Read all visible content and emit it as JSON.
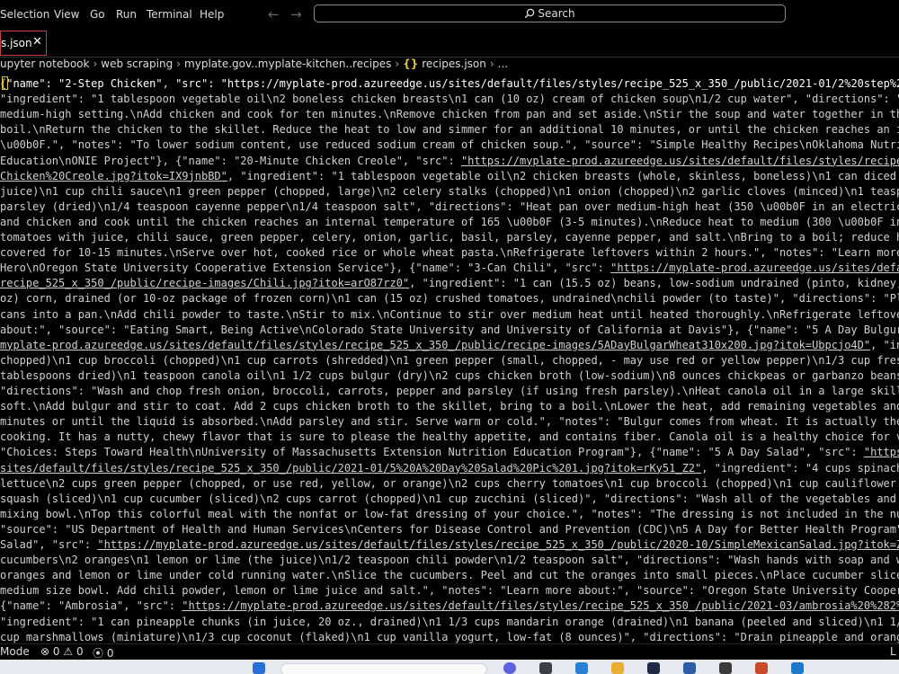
{
  "menu": {
    "items": [
      "Selection",
      "View",
      "Go",
      "Run",
      "Terminal",
      "Help"
    ]
  },
  "nav": {
    "back": "←",
    "forward": "→"
  },
  "search": {
    "label": "Search"
  },
  "tab": {
    "label": "s.json",
    "close": "✕"
  },
  "breadcrumb": {
    "items": [
      "upyter notebook",
      "web scraping",
      "myplate.gov..myplate-kitchen..recipes",
      "recipes.json",
      "..."
    ],
    "braces": "{}"
  },
  "editor": {
    "lines": [
      [
        {
          "t": "{"
        },
        {
          "t": "\"name\": \"2-Step Chicken\"",
          "c": "s"
        },
        {
          "t": ", "
        },
        {
          "t": "\"src\": ",
          "c": "s"
        },
        {
          "t": "\"https://myplate-prod.azureedge.us/sites/default/files/styles/recipe_525_x_350_/public/2021-01/2%20step%20chi",
          "c": "s"
        }
      ],
      [
        {
          "t": "\"ingredient\": \"1 tablespoon vegetable oil\\n2 boneless chicken breasts\\n1 can (10 oz) cream of chicken soup\\n1/2 cup water\", \"directions\": \"Heat o"
        }
      ],
      [
        {
          "t": "medium-high setting.\\nAdd chicken and cook for ten minutes.\\nRemove chicken from pan and set aside.\\nStir the soup and water together in the skil"
        }
      ],
      [
        {
          "t": "boil.\\nReturn the chicken to the skillet. Reduce the heat to low and simmer for an additional 10 minutes, or until the chicken reaches an interna"
        }
      ],
      [
        {
          "t": "\\u00b0F.\", \"notes\": \"To lower sodium content, use reduced sodium cream of chicken soup.\", \"source\": \"Simple Healthy Recipes\\nOklahoma Nutrition I"
        }
      ],
      [
        {
          "t": "Education\\nONIE Project\"}, {\"name\": \"20-Minute Chicken Creole\", \"src\": "
        },
        {
          "t": "\"https://myplate-prod.azureedge.us/sites/default/files/styles/recipe_5",
          "u": true
        }
      ],
      [
        {
          "t": "Chicken%20Creole.jpg?itok=IX9jnbBD\"",
          "u": true
        },
        {
          "t": ", \"ingredient\": \"1 tablespoon vegetable oil\\n2 chicken breasts (whole, skinless, boneless)\\n1 can diced tomato"
        }
      ],
      [
        {
          "t": "juice)\\n1 cup chili sauce\\n1 green pepper (chopped, large)\\n2 celery stalks (chopped)\\n1 onion (chopped)\\n2 garlic cloves (minced)\\n1 teaspoon dr"
        }
      ],
      [
        {
          "t": "parsley (dried)\\n1/4 teaspoon cayenne pepper\\n1/4 teaspoon salt\", \"directions\": \"Heat pan over medium-high heat (350 \\u00b0F in an electric skil"
        }
      ],
      [
        {
          "t": "and chicken and cook until the chicken reaches an internal temperature of 165 \\u00b0F (3-5 minutes).\\nReduce heat to medium (300 \\u00b0F in elect"
        }
      ],
      [
        {
          "t": "tomatoes with juice, chili sauce, green pepper, celery, onion, garlic, basil, parsley, cayenne pepper, and salt.\\nBring to a boil; reduce heat t"
        }
      ],
      [
        {
          "t": "covered for 10-15 minutes.\\nServe over hot, cooked rice or whole wheat pasta.\\nRefrigerate leftovers within 2 hours.\", \"notes\": \"Learn more about"
        }
      ],
      [
        {
          "t": "Hero\\nOregon State University Cooperative Extension Service\"}, {\"name\": \"3-Can Chili\", \"src\": "
        },
        {
          "t": "\"https://myplate-prod.azureedge.us/sites/default/fi",
          "u": true
        }
      ],
      [
        {
          "t": "recipe_525_x_350_/public/recipe-images/Chili.jpg?itok=arO87rz0\"",
          "u": true
        },
        {
          "t": ", \"ingredient\": \"1 can (15.5 oz) beans, low-sodium undrained (pinto, kidney, red,"
        }
      ],
      [
        {
          "t": "oz) corn, drained (or 10-oz package of frozen corn)\\n1 can (15 oz) crushed tomatoes, undrained\\nchili powder (to taste)\", \"directions\": \"Place th"
        }
      ],
      [
        {
          "t": "cans into a pan.\\nAdd chili powder to taste.\\nStir to mix.\\nContinue to stir over medium heat until heated thoroughly.\\nRefrigerate leftovers.\","
        }
      ],
      [
        {
          "t": "about:\", \"source\": \"Eating Smart, Being Active\\nColorado State University and University of California at Davis\"}, {\"name\": \"5 A Day Bulgur Wheat"
        }
      ],
      [
        {
          "t": "myplate-prod.azureedge.us/sites/default/files/styles/recipe_525_x_350_/public/recipe-images/5ADayBulgarWheat310x200.jpg?itok=Ubpcjo4D\"",
          "u": true
        },
        {
          "t": ", \"ingredi"
        }
      ],
      [
        {
          "t": "chopped)\\n1 cup broccoli (chopped)\\n1 cup carrots (shredded)\\n1 green pepper (small, chopped, - may use red or yellow pepper)\\n1/3 cup fresh par"
        }
      ],
      [
        {
          "t": "tablespoons dried)\\n1 teaspoon canola oil\\n1 1/2 cups bulgur (dry)\\n2 cups chicken broth (low-sodium)\\n8 ounces chickpeas or garbanzo beans (cann"
        }
      ],
      [
        {
          "t": "\"directions\": \"Wash and chop fresh onion, broccoli, carrots, pepper and parsley (if using fresh parsley).\\nHeat canola oil in a large skillet. Ad"
        }
      ],
      [
        {
          "t": "soft.\\nAdd bulgur and stir to coat. Add 2 cups chicken broth to the skillet, bring to a boil.\\nLower the heat, add remaining vegetables and chick"
        }
      ],
      [
        {
          "t": "minutes or until the liquid is absorbed.\\nAdd parsley and stir. Serve warm or cold.\", \"notes\": \"Bulgur comes from wheat. It is actually the kerne"
        }
      ],
      [
        {
          "t": "cooking. It has a nutty, chewy flavor that is sure to please the healthy appetite, and contains fiber. Canola oil is a healthy choice for vegeta"
        }
      ],
      [
        {
          "t": "\"Choices: Steps Toward Health\\nUniversity of Massachusetts Extension Nutrition Education Program\"}, {\"name\": \"5 A Day Salad\", \"src\": "
        },
        {
          "t": "\"https://myp",
          "u": true
        }
      ],
      [
        {
          "t": "sites/default/files/styles/recipe_525_x_350_/public/2021-01/5%20A%20Day%20Salad%20Pic%201.jpg?itok=rKy51_Z2\"",
          "u": true
        },
        {
          "t": ", \"ingredient\": \"4 cups spinach (fres"
        }
      ],
      [
        {
          "t": "lettuce\\n2 cups green pepper (chopped, or use red, yellow, or orange)\\n2 cups cherry tomatoes\\n1 cup broccoli (chopped)\\n1 cup cauliflower (chopp"
        }
      ],
      [
        {
          "t": "squash (sliced)\\n1 cup cucumber (sliced)\\n2 cups carrot (chopped)\\n1 cup zucchini (sliced)\", \"directions\": \"Wash all of the vegetables and mix th"
        }
      ],
      [
        {
          "t": "mixing bowl.\\nTop this colorful meal with the nonfat or low-fat dressing of your choice.\", \"notes\": \"The dressing is not included in the nutritio"
        }
      ],
      [
        {
          "t": "\"source\": \"US Department of Health and Human Services\\nCenters for Disease Control and Prevention (CDC)\\n5 A Day for Better Health Program\"}, {\"n"
        }
      ],
      [
        {
          "t": "Salad\", \"src\": "
        },
        {
          "t": "\"https://myplate-prod.azureedge.us/sites/default/files/styles/recipe_525_x_350_/public/2020-10/SimpleMexicanSalad.jpg?itok=Z2ZNQPL",
          "u": true
        }
      ],
      [
        {
          "t": "cucumbers\\n2 oranges\\n1 lemon or lime (the juice)\\n1/2 teaspoon chili powder\\n1/2 teaspoon salt\", \"directions\": \"Wash hands with soap and water.\\"
        }
      ],
      [
        {
          "t": "oranges and lemon or lime under cold running water.\\nSlice the cucumbers. Peel and cut the oranges into small pieces.\\nPlace cucumber slices and"
        }
      ],
      [
        {
          "t": "medium size bowl. Add chili powder, lemon or lime juice and salt.\", \"notes\": \"Learn more about:\", \"source\": \"Oregon State University Cooperative"
        }
      ],
      [
        {
          "t": "{\"name\": \"Ambrosia\", \"src\": "
        },
        {
          "t": "\"https://myplate-prod.azureedge.us/sites/default/files/styles/recipe_525_x_350_/public/2021-03/ambrosia%20%282%29.jp",
          "u": true
        }
      ],
      [
        {
          "t": "\"ingredient\": \"1 can pineapple chunks (in juice, 20 oz., drained)\\n1 1/3 cups mandarin orange (drained)\\n1 banana (peeled and sliced)\\n1 1/2 cups"
        }
      ],
      [
        {
          "t": "cup marshmallows (miniature)\\n1/3 cup coconut (flaked)\\n1 cup vanilla yogurt, low-fat (8 ounces)\", \"directions\": \"Drain pineapple and oranges. Us"
        }
      ]
    ]
  },
  "status": {
    "mode": "Mode",
    "errors": "0",
    "warnings": "0",
    "ports": "0",
    "right": "L"
  },
  "colors": {
    "background": "#000000",
    "tab_border": "#c04040",
    "cursor": "#e0c050",
    "taskbar": "#e6e9ef"
  }
}
